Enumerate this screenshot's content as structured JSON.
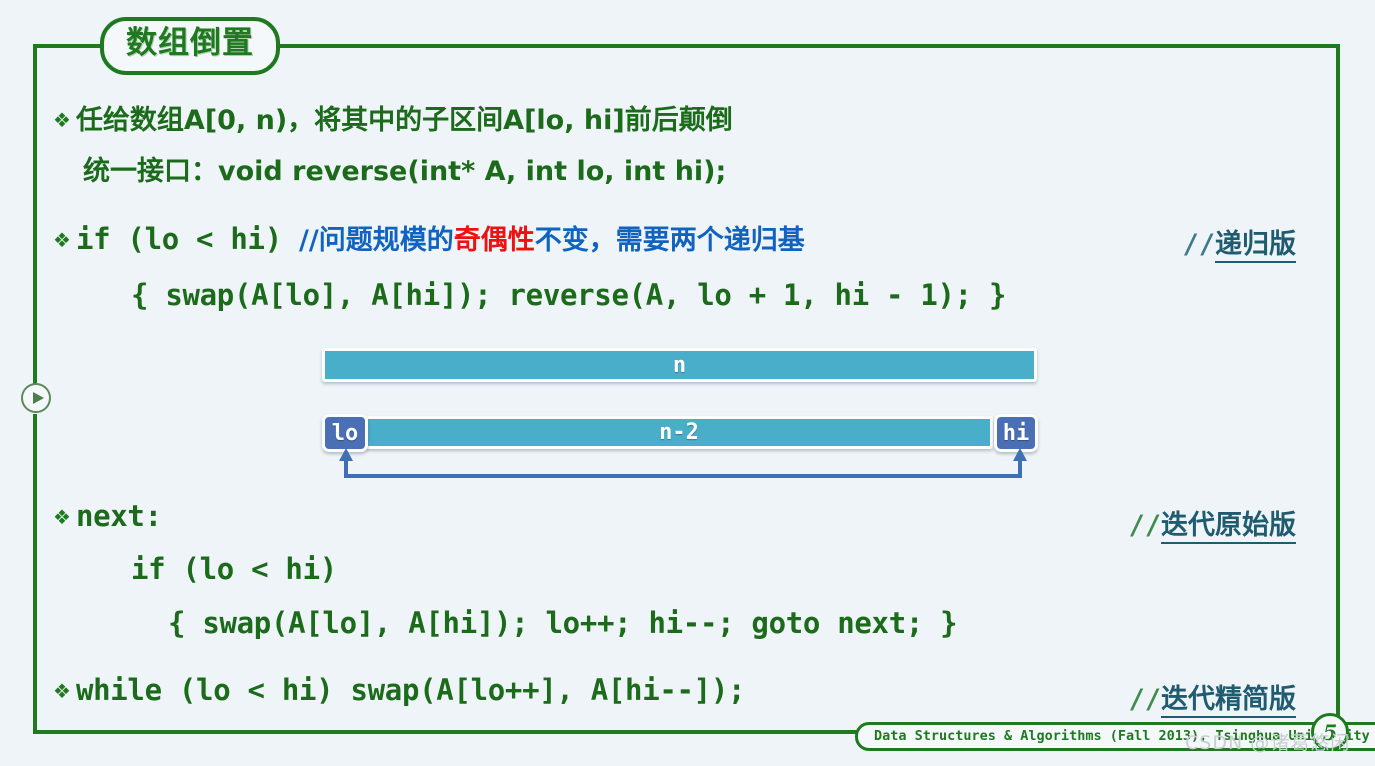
{
  "slide": {
    "title": "数组倒置",
    "play_icon": "play-icon",
    "page_number": "5",
    "footer": "Data Structures & Algorithms (Fall 2013), Tsinghua University",
    "watermark": "CSDN @诸葛悠闲",
    "frame_color": "#1f7a1f",
    "background_color": "#eff4f9"
  },
  "bullets": {
    "b1": "❖",
    "b2": "❖",
    "b3": "❖",
    "b4": "❖"
  },
  "lines": {
    "l1_text": "任给数组A[0, n)，将其中的子区间A[lo, hi]前后颠倒",
    "l2_text": "统一接口：void reverse(int* A, int lo, int hi);",
    "l3_code": "if (lo < hi) ",
    "l3_comment_a": "//问题规模的",
    "l3_comment_b": "奇偶性",
    "l3_comment_c": "不变，需要两个递归基",
    "l4_code": "{ swap(A[lo], A[hi]); reverse(A, lo + 1, hi - 1); }",
    "l5_code": "next:",
    "l6_code": "if (lo < hi)",
    "l7_code": "{ swap(A[lo], A[hi]); lo++; hi--; goto next; }",
    "l8_code": "while (lo < hi) swap(A[lo++], A[hi--]);"
  },
  "notes": {
    "n1_slashes": "//",
    "n1_text": "递归版",
    "n2_slashes": "//",
    "n2_text": "迭代原始版",
    "n3_slashes": "//",
    "n3_text": "迭代精简版"
  },
  "diagram": {
    "bar_full_label": "n",
    "bar_inner_label": "n-2",
    "tag_lo": "lo",
    "tag_hi": "hi",
    "bar_color": "#48aec9",
    "tag_color": "#4a6fb5",
    "arrow_color": "#3f6fb5"
  },
  "colors": {
    "code_green": "#1b6b1b",
    "comment_blue": "#1163c0",
    "highlight_red": "#ef1111",
    "note_teal": "#1f5c70"
  }
}
